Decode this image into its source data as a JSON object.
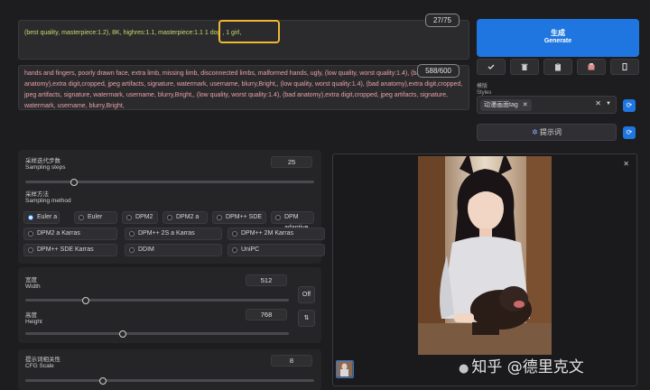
{
  "prompts": {
    "positive_text": "(best quality, masterpiece:1.2), 8K, highres:1.1, masterpiece:1.1 1 dog , 1 girl,",
    "positive_count": "27/75",
    "negative_text": "hands and fingers, poorly drawn face, extra limb, missing limb, disconnected limbs, malformed hands, ugly, (low quality, worst quality:1.4), (bad anatomy),extra digit,cropped, jpeg artifacts, signature, watermark, username, blurry,Bright,, (low quality, worst quality:1.4), (bad anatomy),extra digit,cropped, jpeg artifacts, signature, watermark, username, blurry,Bright,, (low quality, worst quality:1.4), (bad anatomy),extra digit,cropped, jpeg artifacts, signature, watermark, username, blurry,Bright,",
    "negative_count": "588/600"
  },
  "generate": {
    "label_cn": "生成",
    "label_en": "Generate"
  },
  "toolbar": {
    "icons": [
      "check-icon",
      "trash-icon",
      "clipboard-icon",
      "save-style-icon",
      "copy-icon"
    ]
  },
  "styles": {
    "label_cn": "模版",
    "label_en": "Styles",
    "selected": "动漫画面tag",
    "prompt_button": "提示词"
  },
  "sampling": {
    "steps_cn": "采样迭代步数",
    "steps_en": "Sampling steps",
    "steps_value": "25",
    "steps_fraction": 0.17,
    "method_cn": "采样方法",
    "method_en": "Sampling method",
    "methods": [
      "Euler a",
      "Euler",
      "DPM2",
      "DPM2 a",
      "DPM++ SDE",
      "DPM adaptive",
      "DPM2 a Karras",
      "DPM++ 2S a Karras",
      "DPM++ 2M Karras",
      "DPM++ SDE Karras",
      "DDIM",
      "UniPC"
    ],
    "selected_method": "Euler a"
  },
  "size": {
    "width_cn": "宽度",
    "width_en": "Width",
    "width_value": "512",
    "width_fraction": 0.23,
    "height_cn": "高度",
    "height_en": "Height",
    "height_value": "768",
    "height_fraction": 0.37,
    "toggle_label": "Off",
    "swap_icon": "swap-icon"
  },
  "cfg": {
    "label_cn": "提示词相关性",
    "label_en": "CFG Scale",
    "value": "8",
    "fraction": 0.27
  },
  "gallery": {
    "close_icon": "close-icon"
  },
  "watermark": "知乎 @德里克文",
  "colors": {
    "accent": "#1f76e0",
    "positive_prompt": "#c9d96a",
    "negative_prompt": "#e8a0a5",
    "highlight": "#f0b832"
  }
}
